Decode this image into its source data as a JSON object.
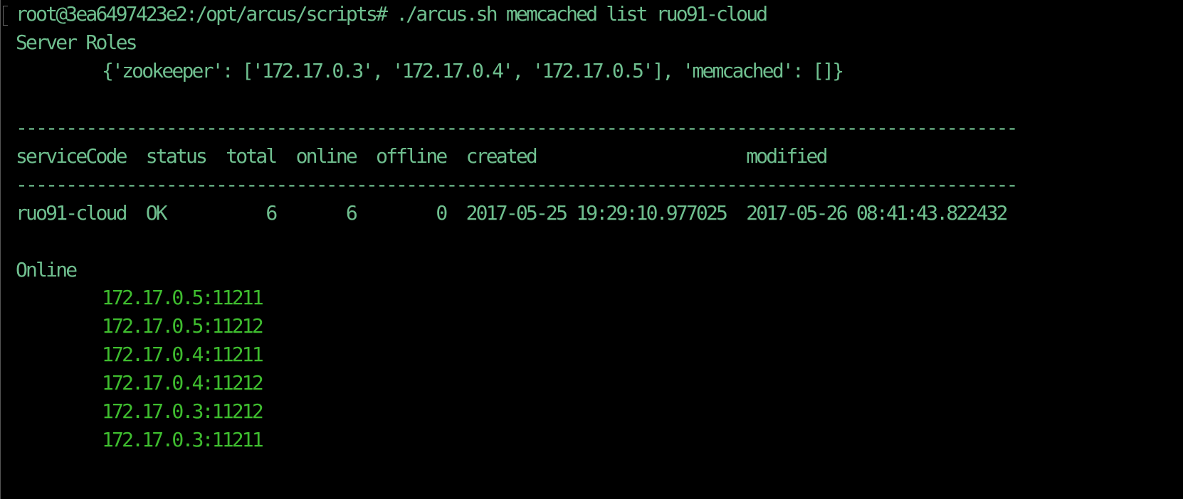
{
  "terminal": {
    "prompt": "root@3ea6497423e2:/opt/arcus/scripts#",
    "command": " ./arcus.sh memcached list ruo91-cloud",
    "server_roles_heading": "Server Roles",
    "server_roles_value": "{'zookeeper': ['172.17.0.3', '172.17.0.4', '172.17.0.5'], 'memcached': []}",
    "separator": "----------------------------------------------------------------------------------------------------",
    "table_header": "serviceCode  status  total  online  offline  created                     modified",
    "table_row": "ruo91-cloud  OK          6       6        0  2017-05-25 19:29:10.977025  2017-05-26 08:41:43.822432",
    "online_heading": "Online",
    "online_servers": [
      "172.17.0.5:11211",
      "172.17.0.5:11212",
      "172.17.0.4:11211",
      "172.17.0.4:11212",
      "172.17.0.3:11212",
      "172.17.0.3:11211"
    ]
  },
  "colors": {
    "background": "#000000",
    "text": "#6fbf8f",
    "online_text": "#3fbd2f"
  }
}
